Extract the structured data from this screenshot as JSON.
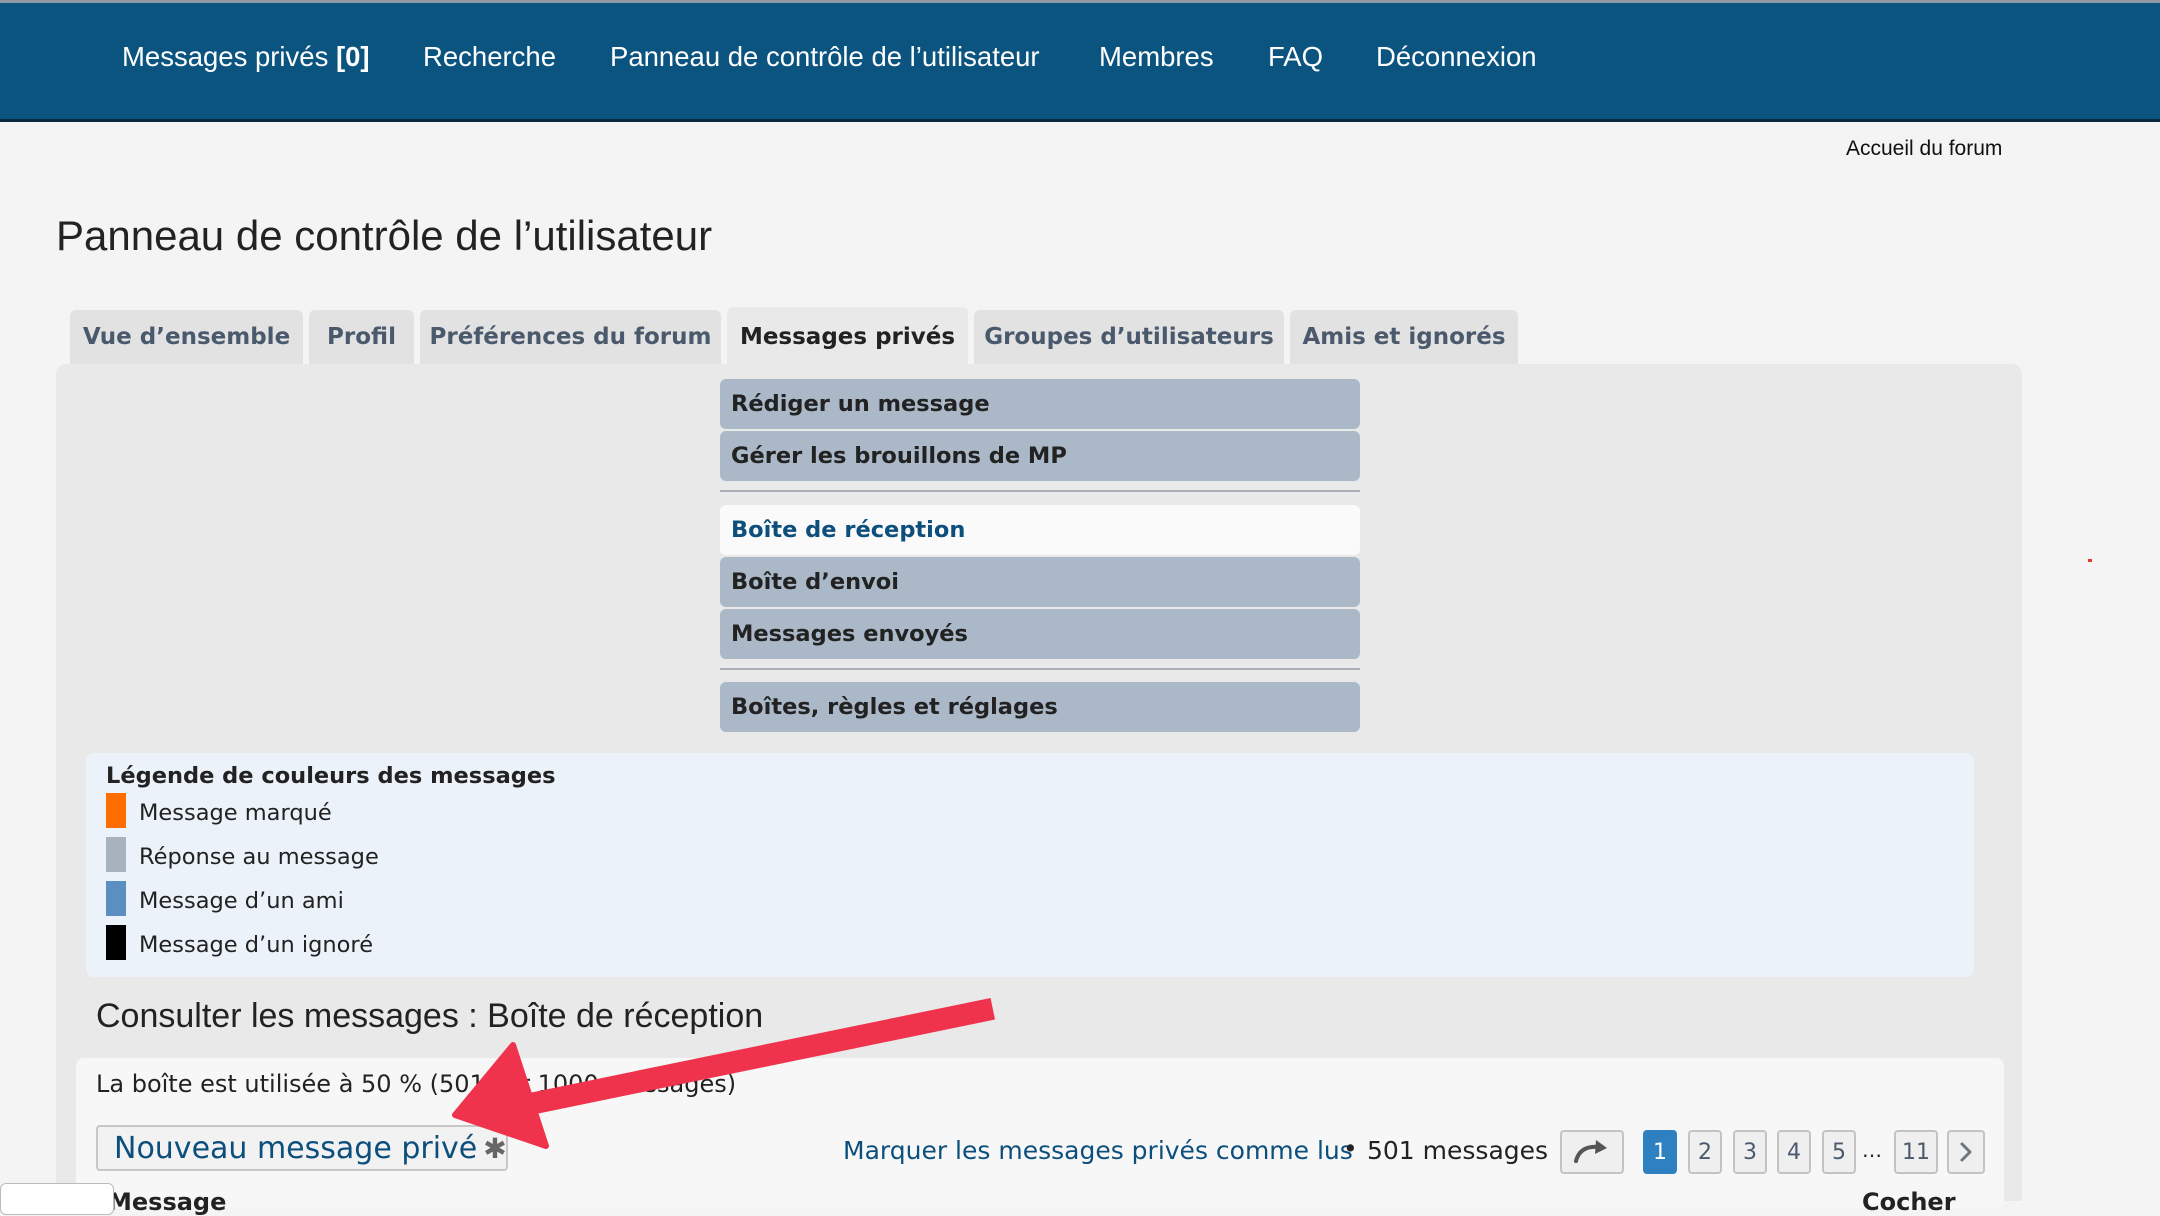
{
  "navbar": {
    "items": [
      "Messages privés",
      "Recherche",
      "Panneau de contrôle de l’utilisateur",
      "Membres",
      "FAQ",
      "Déconnexion"
    ],
    "pm_count": "[0]"
  },
  "header": {
    "forum_home": "Accueil du forum",
    "page_title": "Panneau de contrôle de l’utilisateur"
  },
  "tabs": [
    "Vue d’ensemble",
    "Profil",
    "Préférences du forum",
    "Messages privés",
    "Groupes d’utilisateurs",
    "Amis et ignorés"
  ],
  "active_tab": "Messages privés",
  "submenu": {
    "items": [
      "Rédiger un message",
      "Gérer les brouillons de MP",
      "Boîte de réception",
      "Boîte d’envoi",
      "Messages envoyés",
      "Boîtes, règles et réglages"
    ],
    "active": "Boîte de réception"
  },
  "legend": {
    "title": "Légende de couleurs des messages",
    "entries": [
      {
        "label": "Message marqué",
        "color": "#ff6c00"
      },
      {
        "label": "Réponse au message",
        "color": "#a8b2bd"
      },
      {
        "label": "Message d’un ami",
        "color": "#5c8fc1"
      },
      {
        "label": "Message d’un ignoré",
        "color": "#000000"
      }
    ]
  },
  "messages": {
    "section_title": "Consulter les messages : Boîte de réception",
    "usage_text": "La boîte est utilisée à 50 % (501 sur 1000 messages)",
    "new_pm_label": "Nouveau message privé",
    "mark_read_label": "Marquer les messages privés comme lus",
    "bullet": "•",
    "message_count": "501 messages",
    "pagination": {
      "pages": [
        "1",
        "2",
        "3",
        "4",
        "5"
      ],
      "ellipsis": "…",
      "last_page": "11",
      "current_page": "1"
    },
    "columns": {
      "message": "Message",
      "check": "Cocher"
    }
  },
  "colors": {
    "navbar": "#0c5480",
    "link": "#0c4f7c",
    "submenu_item": "#aab8c8",
    "legend_background": "#ecf2f9",
    "annotation_arrow": "#f0334d",
    "pagination_active": "#2d81c0"
  }
}
